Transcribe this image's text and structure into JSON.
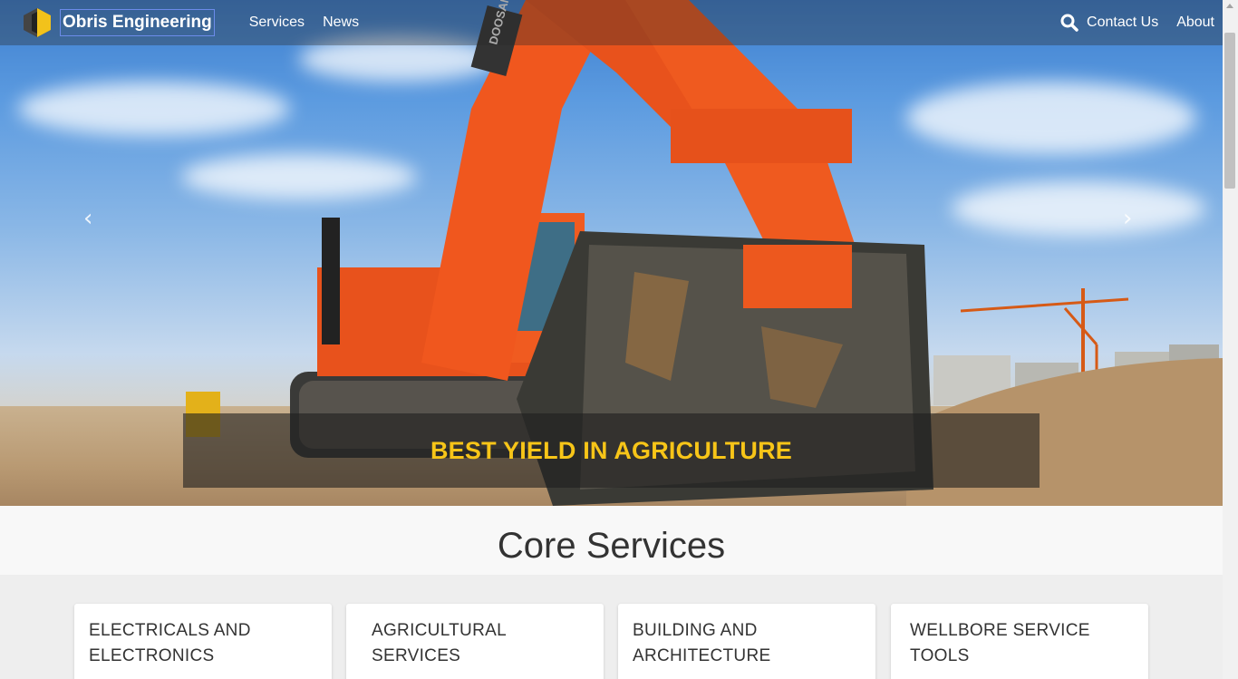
{
  "navbar": {
    "brand": "Obris Engineering",
    "links": [
      "Services",
      "News"
    ],
    "right_links": [
      "Contact Us",
      "About"
    ],
    "search_icon": "search-icon"
  },
  "hero": {
    "caption": "BEST YIELD IN AGRICULTURE",
    "prev_icon": "chevron-left-icon",
    "next_icon": "chevron-right-icon",
    "excavator_brand": "DOOSAN"
  },
  "core_services": {
    "title": "Core Services",
    "cards": [
      "ELECTRICALS AND ELECTRONICS",
      "AGRICULTURAL SERVICES",
      "BUILDING AND ARCHITECTURE",
      "WELLBORE SERVICE TOOLS"
    ]
  },
  "colors": {
    "caption_text": "#f7c518",
    "excavator_orange": "#f0571e",
    "navbar_overlay": "rgba(40,40,40,0.35)"
  }
}
